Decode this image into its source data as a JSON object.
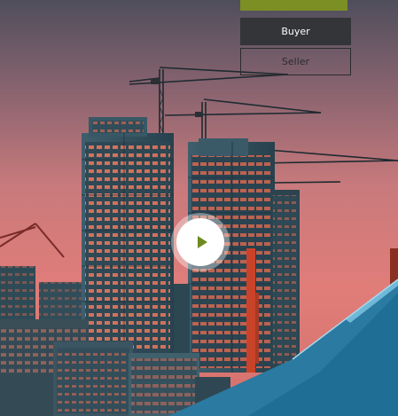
{
  "actions": {
    "buyer_label": "Buyer",
    "seller_label": "Seller"
  },
  "video": {
    "play_icon": "play-icon"
  },
  "colors": {
    "accent_green": "#7c8f24",
    "buyer_bg": "#333538",
    "seller_border": "#2c2c2c",
    "play_triangle": "#6f8a1f"
  }
}
